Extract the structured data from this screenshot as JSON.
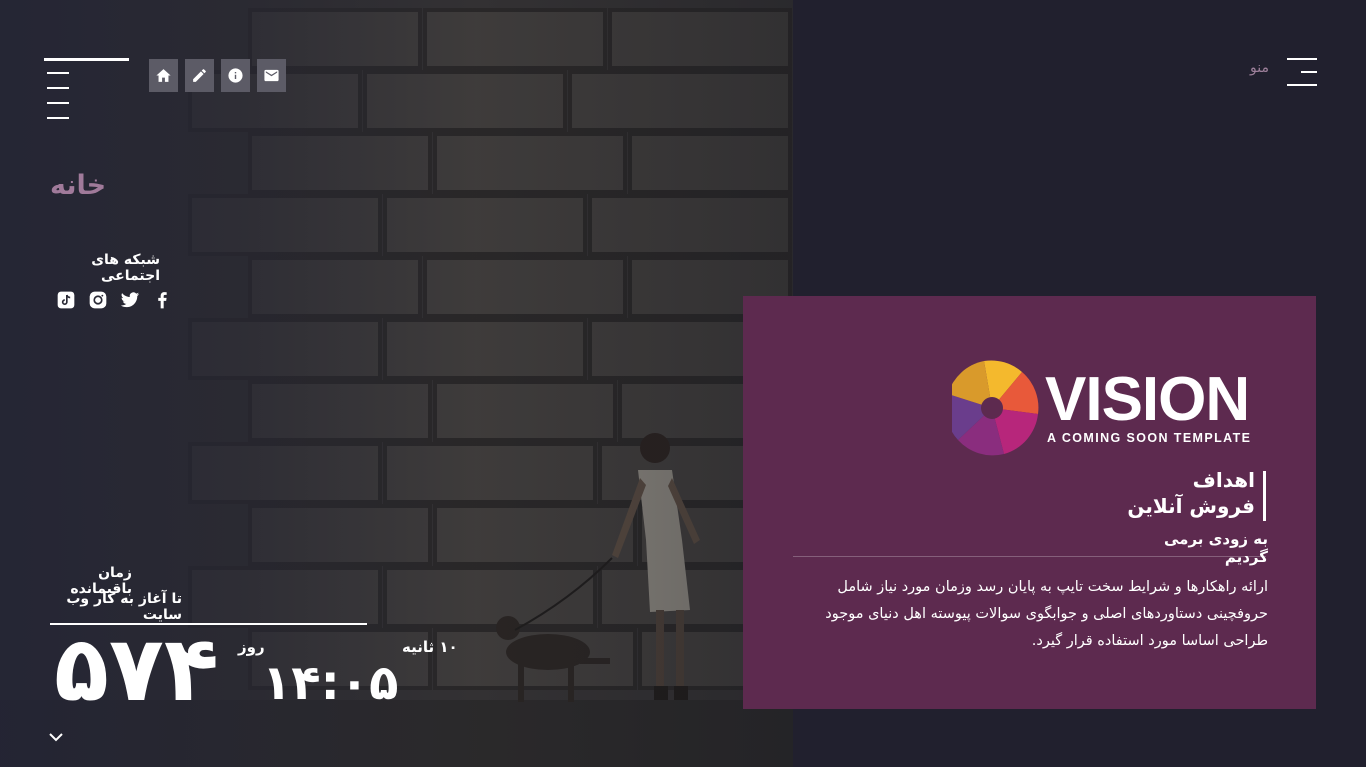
{
  "nav": {
    "icons": [
      "home-icon",
      "pencil-icon",
      "info-icon",
      "mail-icon"
    ]
  },
  "page_title": "خانه",
  "social": {
    "title": "شبکه های اجتماعی",
    "icons": [
      "tiktok-icon",
      "instagram-icon",
      "twitter-icon",
      "facebook-icon"
    ]
  },
  "countdown": {
    "label_line1": "زمان باقیمانده",
    "label_line2": "تا آغاز به کار وب سایت",
    "days": "۵۷۴",
    "days_label": "روز",
    "time": "۱۴:۰۵",
    "seconds": "۱۰ ثانیه"
  },
  "menu": {
    "label": "منو"
  },
  "logo": {
    "word": "VISION",
    "tagline": "A COMING SOON TEMPLATE"
  },
  "card": {
    "goals_line1": "اهداف",
    "goals_line2": "فروش آنلاین",
    "soon": "به زودی برمی گردیم",
    "description": "ارائه راهکارها و شرایط سخت تایپ به پایان رسد وزمان مورد نیاز شامل حروفچینی دستاوردهای اصلی و جوابگوی سوالات پیوسته اهل دنیای موجود طراحی اساسا مورد استفاده قرار گیرد."
  },
  "colors": {
    "background": "#21202e",
    "card": "#5d2a4f",
    "title_accent": "#a07a9a",
    "menu_label": "#9e809b",
    "logo_yellow": "#f4b92d",
    "logo_orange": "#e8593a",
    "logo_magenta": "#b7267b",
    "logo_purple": "#6a3d8c"
  }
}
